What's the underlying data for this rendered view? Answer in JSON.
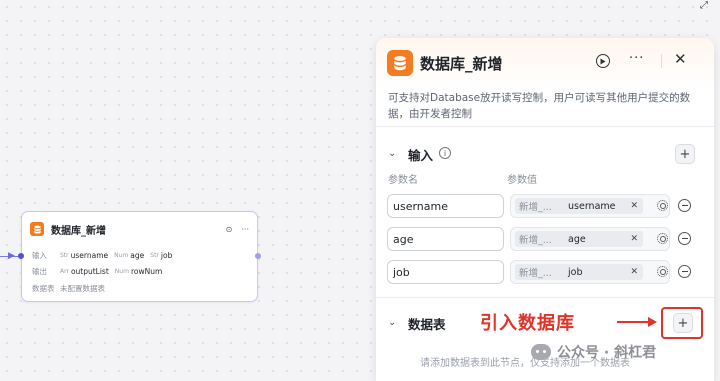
{
  "node": {
    "title": "数据库_新增",
    "run_symbol": "⊙",
    "more_symbol": "···",
    "input_label": "输入",
    "inputs": [
      {
        "type": "Str",
        "name": "username"
      },
      {
        "type": "Num",
        "name": "age"
      },
      {
        "type": "Str",
        "name": "job"
      }
    ],
    "output_label": "输出",
    "outputs": [
      {
        "type": "Arr",
        "name": "outputList"
      },
      {
        "type": "Num",
        "name": "rowNum"
      }
    ],
    "table_label": "数据表",
    "table_empty": "未配置数据表"
  },
  "panel": {
    "title": "数据库_新增",
    "more_symbol": "···",
    "close_symbol": "✕",
    "description": "可支持对Database放开读写控制，用户可读写其他用户提交的数据，由开发者控制",
    "input_section": {
      "title": "输入",
      "info_symbol": "i",
      "add_symbol": "+",
      "col_name": "参数名",
      "col_value": "参数值",
      "params": [
        {
          "name": "username",
          "source": "新增_...",
          "value": "username"
        },
        {
          "name": "age",
          "source": "新增_...",
          "value": "age"
        },
        {
          "name": "job",
          "source": "新增_...",
          "value": "job"
        }
      ]
    },
    "table_section": {
      "title": "数据表",
      "add_symbol": "+",
      "annotation": "引入数据库",
      "empty_hint": "请添加数据表到此节点，仅支持添加一个数据表"
    }
  },
  "watermark": {
    "text": "公众号 · 斜杠君"
  },
  "colors": {
    "accent_orange": "#f47b20",
    "annotation_red": "#e0332a",
    "node_border": "#c9c6f2"
  },
  "icons": {
    "expand": "expand-icon"
  }
}
